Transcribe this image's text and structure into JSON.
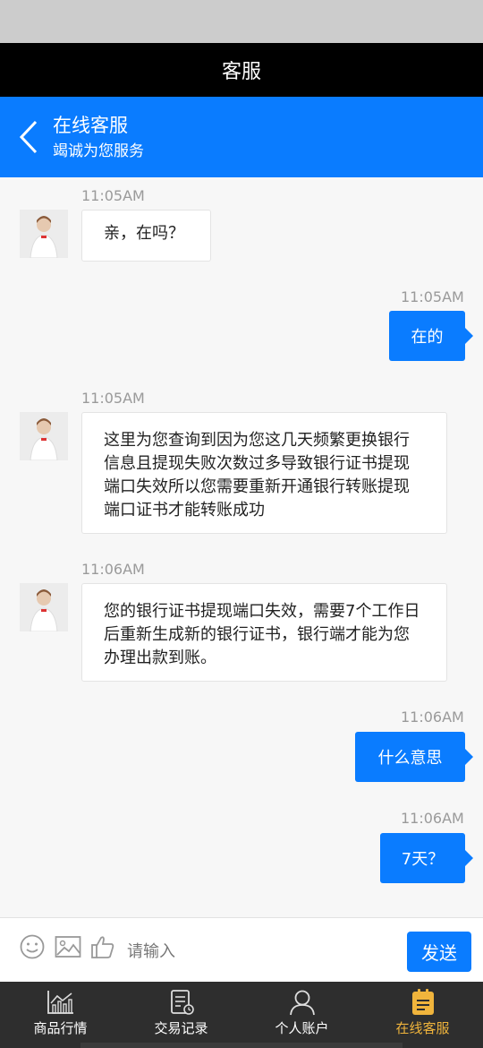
{
  "window": {
    "title": "客服"
  },
  "chat_header": {
    "title": "在线客服",
    "subtitle": "竭诚为您服务"
  },
  "messages": [
    {
      "side": "in",
      "time": "11:05AM",
      "text": "亲，在吗？"
    },
    {
      "side": "out",
      "time": "11:05AM",
      "text": "在的"
    },
    {
      "side": "in",
      "time": "11:05AM",
      "text": "这里为您查询到因为您这几天频繁更换银行信息且提现失败次数过多导致银行证书提现端口失效所以您需要重新开通银行转账提现端口证书才能转账成功"
    },
    {
      "side": "in",
      "time": "11:06AM",
      "text": "您的银行证书提现端口失效，需要7个工作日后重新生成新的银行证书，银行端才能为您办理出款到账。"
    },
    {
      "side": "out",
      "time": "11:06AM",
      "text": "什么意思"
    },
    {
      "side": "out",
      "time": "11:06AM",
      "text": "7天？"
    }
  ],
  "input_bar": {
    "icons": [
      "emoji-icon",
      "image-icon",
      "thumbs-up-icon"
    ],
    "placeholder": "请输入",
    "send_label": "发送"
  },
  "tabs": [
    {
      "label": "商品行情",
      "icon": "chart-icon",
      "active": false
    },
    {
      "label": "交易记录",
      "icon": "record-icon",
      "active": false
    },
    {
      "label": "个人账户",
      "icon": "user-icon",
      "active": false
    },
    {
      "label": "在线客服",
      "icon": "service-icon",
      "active": true
    }
  ],
  "colors": {
    "primary": "#0a7cff",
    "title_bar": "#000000",
    "tab_bar": "#2e2e2e",
    "active_tab": "#f0b43c"
  }
}
